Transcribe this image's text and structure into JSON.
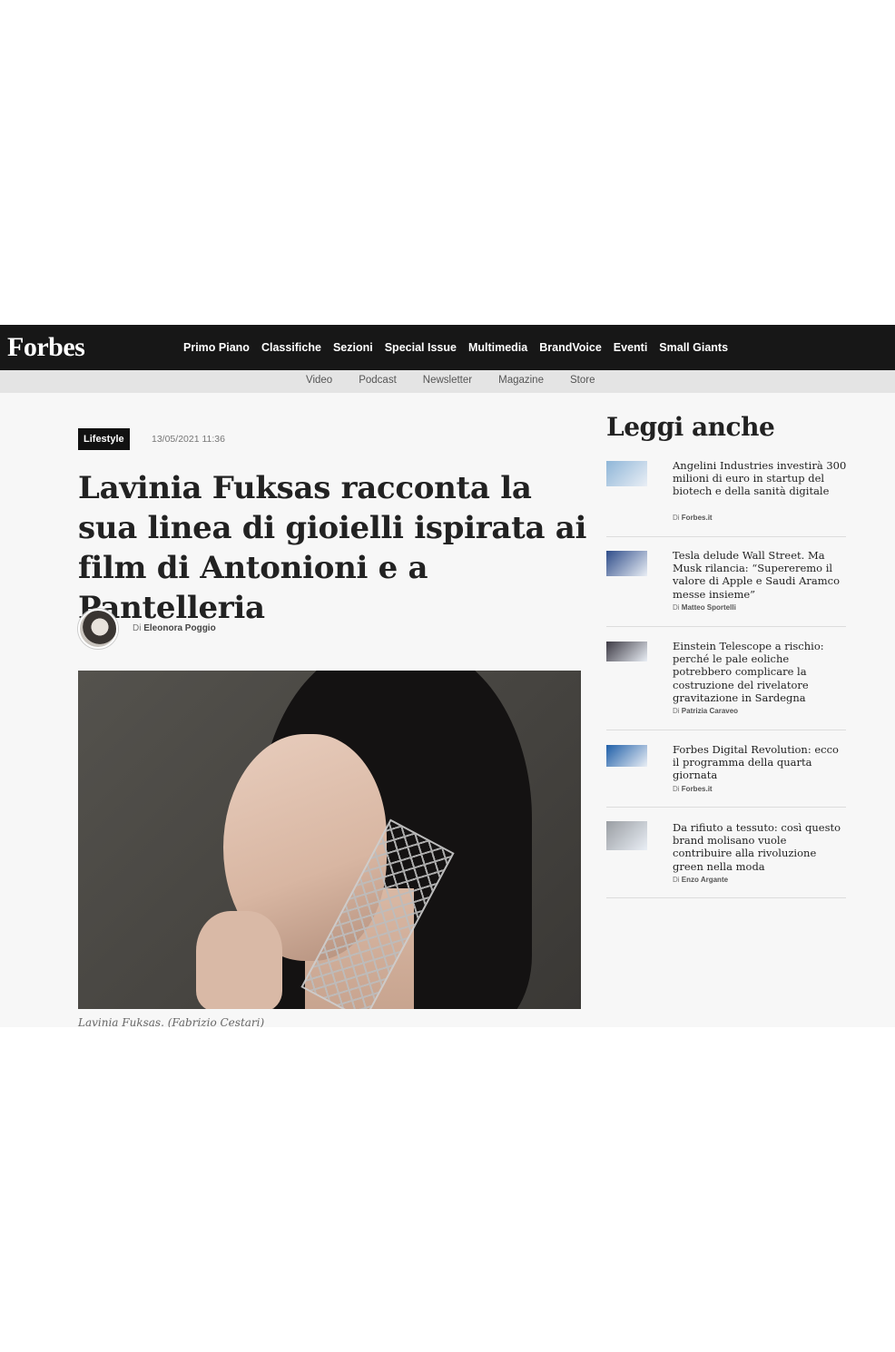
{
  "brand": "Forbes",
  "main_nav": [
    "Primo Piano",
    "Classifiche",
    "Sezioni",
    "Special Issue",
    "Multimedia",
    "BrandVoice",
    "Eventi",
    "Small Giants"
  ],
  "sub_nav": [
    "Video",
    "Podcast",
    "Newsletter",
    "Magazine",
    "Store"
  ],
  "article": {
    "category": "Lifestyle",
    "datetime": "13/05/2021 11:36",
    "title": "Lavinia Fuksas racconta la sua linea di gioielli ispirata ai film di Antonioni e a Pantelleria",
    "byline_prefix": "Di",
    "author": "Eleonora Poggio",
    "caption": "Lavinia Fuksas. (Fabrizio Cestari)"
  },
  "sidebar": {
    "title": "Leggi anche",
    "items": [
      {
        "title": "Angelini Industries investirà 300 milioni di euro in startup del biotech e della sanità digitale",
        "prefix": "Di",
        "author": "Forbes.it",
        "thumb_color": "#8fb6d8"
      },
      {
        "title": "Tesla delude Wall Street. Ma Musk rilancia: “Supereremo il valore di Apple e Saudi Aramco messe insieme”",
        "prefix": "Di",
        "author": "Matteo Sportelli",
        "thumb_color": "#2f4d8a"
      },
      {
        "title": "Einstein Telescope a rischio: perché le pale eoliche potrebbero complicare la costruzione del rivelatore gravitazione in Sardegna",
        "prefix": "Di",
        "author": "Patrizia Caraveo",
        "thumb_color": "#3d3a44"
      },
      {
        "title": "Forbes Digital Revolution: ecco il programma della quarta giornata",
        "prefix": "Di",
        "author": "Forbes.it",
        "thumb_color": "#1f5fa8"
      },
      {
        "title": "Da rifiuto a tessuto: così questo brand molisano vuole contribuire alla rivoluzione green nella moda",
        "prefix": "Di",
        "author": "Enzo Argante",
        "thumb_color": "#9a9ea3"
      }
    ]
  }
}
